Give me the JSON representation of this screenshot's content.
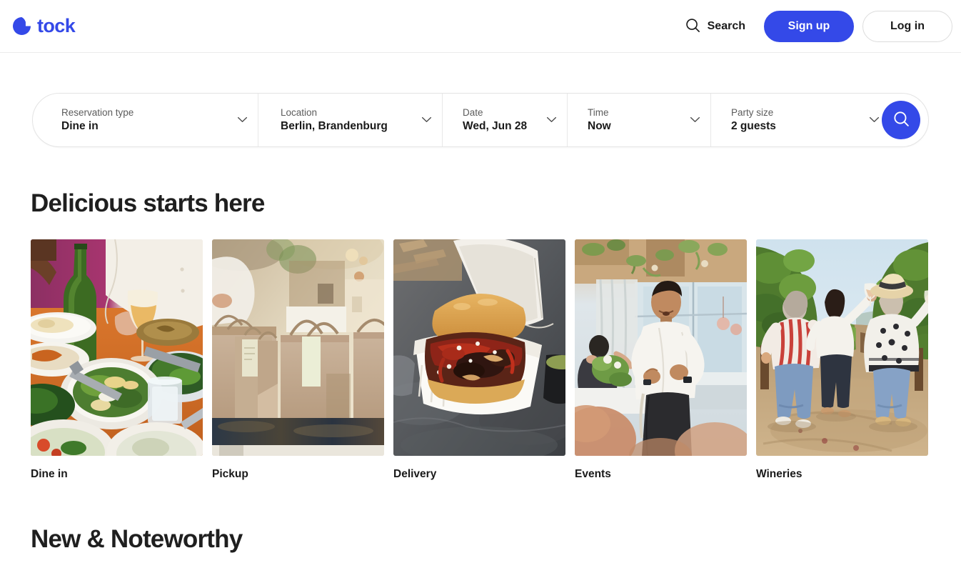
{
  "header": {
    "logo_text": "tock",
    "logo_icon": "tock-circle-logo",
    "search_label": "Search",
    "search_icon": "search-icon",
    "signup_label": "Sign up",
    "login_label": "Log in"
  },
  "search_bar": {
    "fields": [
      {
        "label": "Reservation type",
        "value": "Dine in",
        "icon": "chevron-down-icon"
      },
      {
        "label": "Location",
        "value": "Berlin, Brandenburg",
        "icon": "chevron-down-icon"
      },
      {
        "label": "Date",
        "value": "Wed, Jun 28",
        "icon": "chevron-down-icon"
      },
      {
        "label": "Time",
        "value": "Now",
        "icon": "chevron-down-icon"
      },
      {
        "label": "Party size",
        "value": "2 guests",
        "icon": "chevron-down-icon"
      }
    ],
    "submit_icon": "search-icon"
  },
  "main": {
    "section_title": "Delicious starts here",
    "categories": [
      {
        "label": "Dine in",
        "image": "dining-table-with-food-and-wine-bottle"
      },
      {
        "label": "Pickup",
        "image": "paper-takeout-bags-on-counter"
      },
      {
        "label": "Delivery",
        "image": "bbq-sandwich-in-takeout-container"
      },
      {
        "label": "Events",
        "image": "chef-speaking-to-guests-in-dining-room"
      },
      {
        "label": "Wineries",
        "image": "three-people-walking-in-vineyard"
      }
    ],
    "next_section_title": "New & Noteworthy"
  },
  "colors": {
    "brand_blue": "#3449e8",
    "text_dark": "#1a1a1a",
    "text_muted": "#5c5c5c",
    "border": "#e4e4e4"
  }
}
